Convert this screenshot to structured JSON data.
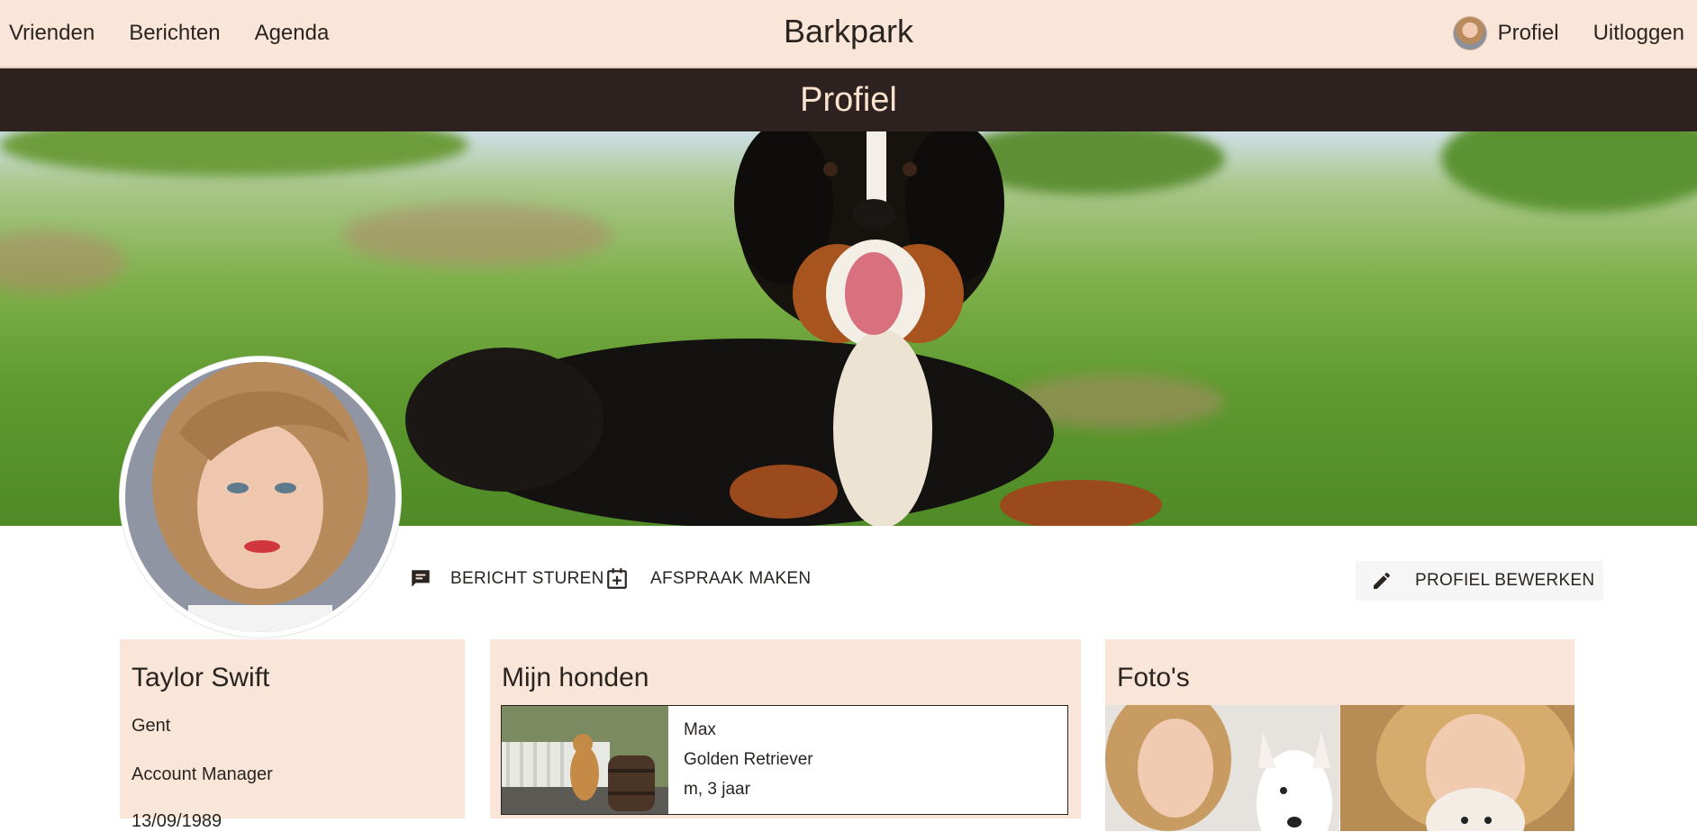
{
  "nav": {
    "left": [
      "Vrienden",
      "Berichten",
      "Agenda"
    ],
    "brand": "Barkpark",
    "profile": "Profiel",
    "logout": "Uitloggen"
  },
  "page_title": "Profiel",
  "actions": {
    "message": "BERICHT STUREN",
    "appointment": "AFSPRAAK MAKEN",
    "edit": "PROFIEL BEWERKEN"
  },
  "profile": {
    "name": "Taylor Swift",
    "city": "Gent",
    "job": "Account Manager",
    "birthdate": "13/09/1989"
  },
  "dogs": {
    "title": "Mijn honden",
    "items": [
      {
        "name": "Max",
        "breed": "Golden Retriever",
        "details": "m, 3 jaar"
      }
    ]
  },
  "photos": {
    "title": "Foto's"
  },
  "colors": {
    "nav_bg": "#fae6d8",
    "title_bar_bg": "#2d221f",
    "title_text": "#fbe3cf",
    "card_bg": "#fae6d8"
  }
}
